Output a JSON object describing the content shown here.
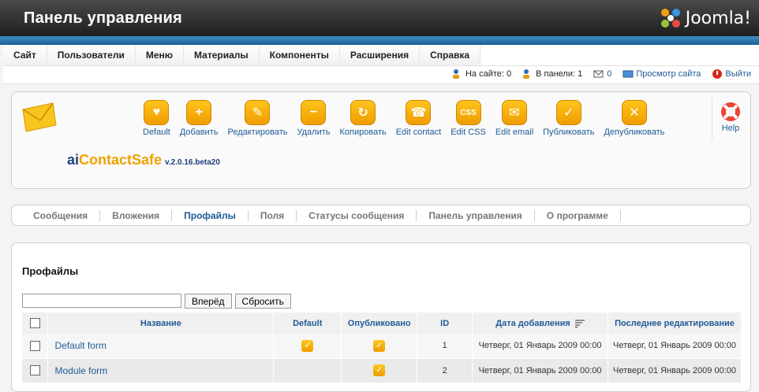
{
  "header": {
    "title": "Панель управления",
    "logo": "Joomla!"
  },
  "menu": [
    "Сайт",
    "Пользователи",
    "Меню",
    "Материалы",
    "Компоненты",
    "Расширения",
    "Справка"
  ],
  "status": {
    "online": "На сайте: 0",
    "admin": "В панели: 1",
    "messages": "0",
    "preview": "Просмотр сайта",
    "logout": "Выйти"
  },
  "toolbar": [
    {
      "label": "Default",
      "icon": "heart-icon"
    },
    {
      "label": "Добавить",
      "icon": "plus-icon"
    },
    {
      "label": "Редактировать",
      "icon": "pencil-icon"
    },
    {
      "label": "Удалить",
      "icon": "minus-icon"
    },
    {
      "label": "Копировать",
      "icon": "copy-icon"
    },
    {
      "label": "Edit contact",
      "icon": "phone-icon"
    },
    {
      "label": "Edit CSS",
      "icon": "css-icon"
    },
    {
      "label": "Edit email",
      "icon": "mail-icon"
    },
    {
      "label": "Публиковать",
      "icon": "publish-icon"
    },
    {
      "label": "Депубликовать",
      "icon": "unpublish-icon"
    }
  ],
  "help": "Help",
  "brand": {
    "ai": "ai",
    "name": "ContactSafe",
    "version": "v.2.0.16.beta20"
  },
  "subnav": [
    "Сообщения",
    "Вложения",
    "Профайлы",
    "Поля",
    "Статусы сообщения",
    "Панель управления",
    "О программе"
  ],
  "subnav_active": "Профайлы",
  "section_title": "Профайлы",
  "filter": {
    "value": "",
    "go": "Вперёд",
    "reset": "Сбросить"
  },
  "table": {
    "headers": [
      "Название",
      "Default",
      "Опубликовано",
      "ID",
      "Дата добавления",
      "Последнее редактирование"
    ],
    "rows": [
      {
        "name": "Default form",
        "default": true,
        "published": true,
        "id": "1",
        "created": "Четверг, 01 Январь 2009 00:00",
        "modified": "Четверг, 01 Январь 2009 00:00"
      },
      {
        "name": "Module form",
        "default": false,
        "published": true,
        "id": "2",
        "created": "Четверг, 01 Январь 2009 00:00",
        "modified": "Четверг, 01 Январь 2009 00:00"
      }
    ]
  },
  "colors": {
    "accent": "#f0a100",
    "link": "#1f5a96",
    "header": "#2c2c2c",
    "bar": "#2a78b4"
  }
}
